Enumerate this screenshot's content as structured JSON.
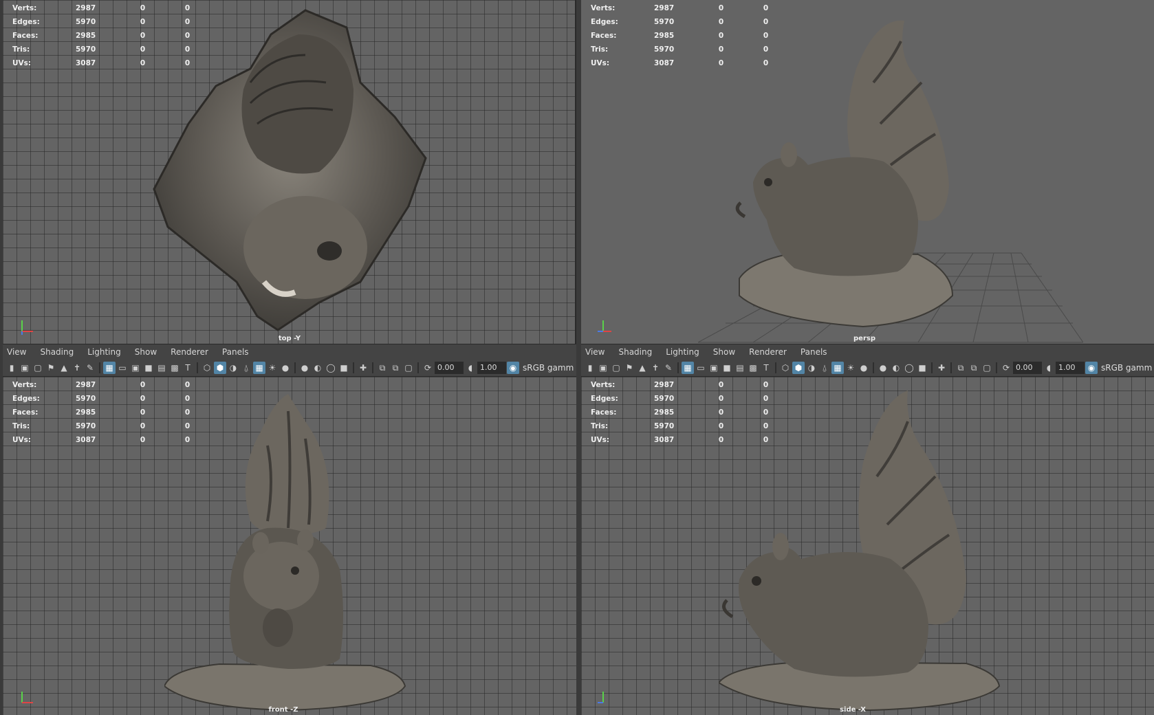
{
  "hud_labels": {
    "verts": "Verts:",
    "edges": "Edges:",
    "faces": "Faces:",
    "tris": "Tris:",
    "uvs": "UVs:"
  },
  "hud_values": {
    "verts": [
      "2987",
      "0",
      "0"
    ],
    "edges": [
      "5970",
      "0",
      "0"
    ],
    "faces": [
      "2985",
      "0",
      "0"
    ],
    "tris": [
      "5970",
      "0",
      "0"
    ],
    "uvs": [
      "3087",
      "0",
      "0"
    ]
  },
  "viewports": {
    "top": {
      "camera": "top -Y"
    },
    "persp": {
      "camera": "persp"
    },
    "front": {
      "camera": "front -Z"
    },
    "side": {
      "camera": "side -X"
    }
  },
  "menu": {
    "view": "View",
    "shading": "Shading",
    "lighting": "Lighting",
    "show": "Show",
    "renderer": "Renderer",
    "panels": "Panels"
  },
  "toolbar": {
    "exposure": "0.00",
    "gamma": "1.00",
    "color_space": "sRGB gamm"
  },
  "axis_labels": {
    "x": "x",
    "y": "y",
    "z": "z"
  },
  "colors": {
    "viewport_bg": "#646464",
    "accent": "#5285a6",
    "panel_bg": "#444444"
  }
}
